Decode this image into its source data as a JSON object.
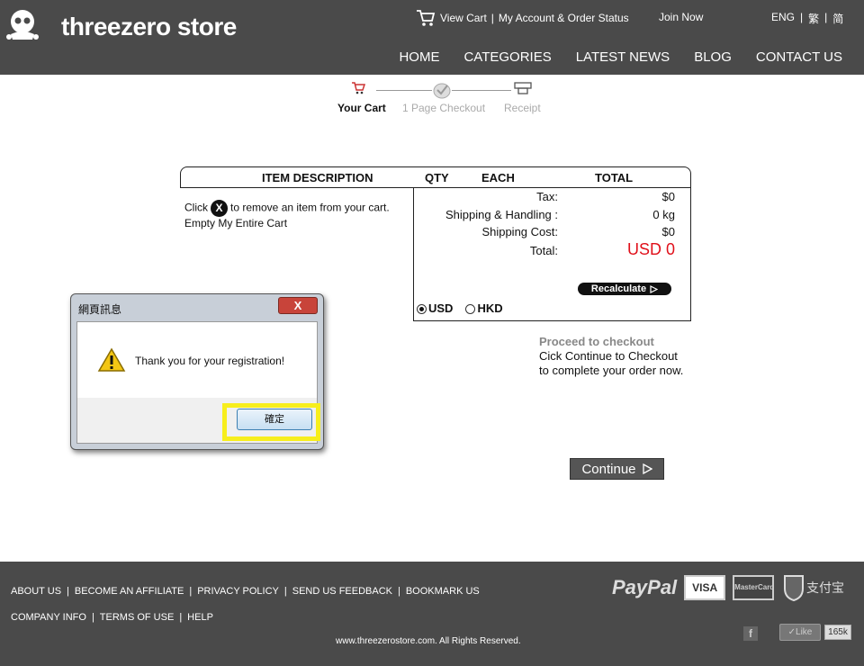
{
  "header": {
    "brand": "threezero store",
    "view_cart": "View Cart",
    "sep": "|",
    "my_account": "My Account & Order Status",
    "join_now": "Join Now",
    "lang": [
      "ENG",
      "|",
      "繁",
      "|",
      "简"
    ],
    "nav": [
      "HOME",
      "CATEGORIES",
      "LATEST NEWS",
      "BLOG",
      "CONTACT US"
    ]
  },
  "steps": {
    "cart": "Your Cart",
    "checkout": "1 Page Checkout",
    "receipt": "Receipt"
  },
  "cart": {
    "headers": {
      "desc": "ITEM DESCRIPTION",
      "qty": "QTY",
      "each": "EACH",
      "total": "TOTAL"
    },
    "remove_prefix": "Click",
    "remove_x": "X",
    "remove_suffix": "to remove an item from your cart.",
    "empty_cart": "Empty My Entire Cart",
    "summary": {
      "tax_label": "Tax:",
      "tax_value": "$0",
      "shipping_label": "Shipping & Handling :",
      "shipping_value": "0 kg",
      "cost_label": "Shipping Cost:",
      "cost_value": "$0",
      "total_label": "Total:",
      "total_value": "USD 0"
    },
    "recalculate": "Recalculate",
    "currency": {
      "usd": "USD",
      "hkd": "HKD",
      "selected": "USD"
    }
  },
  "proceed": {
    "title": "Proceed to checkout",
    "line1": "Cick Continue to Checkout",
    "line2": "to complete your order now."
  },
  "continue_label": "Continue",
  "dialog": {
    "title": "網頁訊息",
    "close": "X",
    "message": "Thank you for your registration!",
    "ok": "確定",
    "highlight_color": "#f7ee1c"
  },
  "footer": {
    "links_row1": [
      "ABOUT US",
      "BECOME AN AFFILIATE",
      "PRIVACY POLICY",
      "SEND US FEEDBACK",
      "BOOKMARK US"
    ],
    "links_row2": [
      "COMPANY INFO",
      "TERMS OF USE",
      "HELP"
    ],
    "sep": "|",
    "copyright": "www.threezerostore.com. All Rights Reserved.",
    "paypal": "PayPal",
    "visa": "VISA",
    "mastercard": "MasterCard",
    "alipay": "支付宝",
    "fb": "f",
    "like": "✓Like",
    "like_count": "165k"
  },
  "colors": {
    "header_bg": "#4a4a4a",
    "total_red": "#e0101a",
    "proceed_grey": "#888888"
  }
}
